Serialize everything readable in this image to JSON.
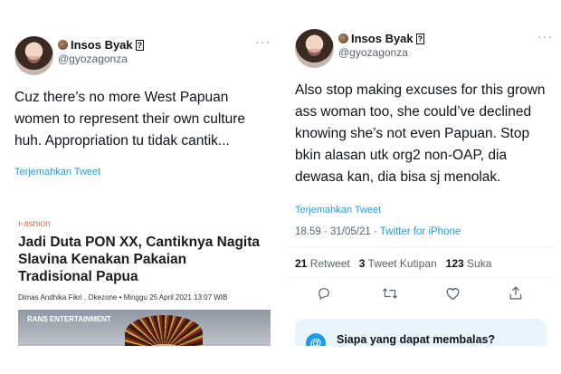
{
  "left_tweet": {
    "display_name": "Insos Byak",
    "verified_glyph": "?",
    "handle": "@gyozagonza",
    "more": "···",
    "text": "Cuz there’s no more West Papuan women to represent their own culture huh. Appropriation tu tidak cantik...",
    "translate": "Terjemahkan Tweet",
    "article": {
      "category": "Fashion",
      "title": "Jadi Duta PON XX, Cantiknya Nagita Slavina Kenakan Pakaian Tradisional Papua",
      "meta": "Dimas Andhika Fikri , Okezone  •  Minggu 25 April 2021 13:07 WIB",
      "image_logo": "RANS ENTERTAINMENT"
    }
  },
  "right_tweet": {
    "display_name": "Insos Byak",
    "verified_glyph": "?",
    "handle": "@gyozagonza",
    "more": "···",
    "text": "Also stop making excuses for this grown ass woman too, she could’ve declined knowing she’s not even Papuan. Stop bkin alasan utk org2 non-OAP, dia dewasa kan, dia bisa sj menolak.",
    "translate": "Terjemahkan Tweet",
    "time": "18.59 · 31/05/21 · ",
    "source": "Twitter for iPhone",
    "stats": {
      "retweets_count": "21",
      "retweets_label": "Retweet",
      "quotes_count": "3",
      "quotes_label": "Tweet Kutipan",
      "likes_count": "123",
      "likes_label": "Suka"
    },
    "reply_box": {
      "icon": "@",
      "title": "Siapa yang dapat membalas?"
    }
  },
  "icons": {
    "reply": "reply-icon",
    "retweet": "retweet-icon",
    "like": "heart-icon",
    "share": "share-icon"
  },
  "colors": {
    "link": "#1d9bf0",
    "text": "#0f1419",
    "secondary": "#536471",
    "article_category": "#e36d4a"
  }
}
